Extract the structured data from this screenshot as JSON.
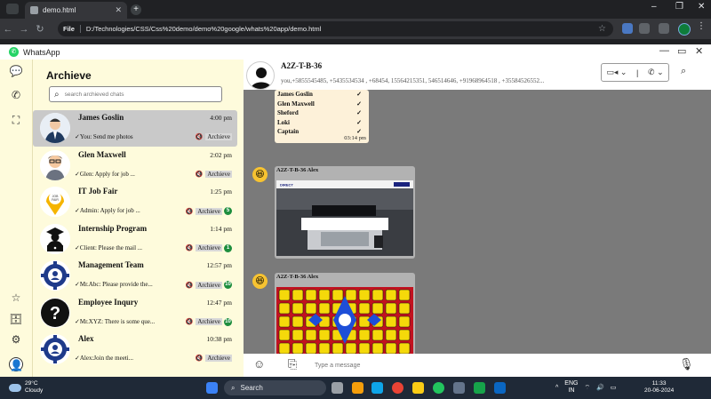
{
  "browser": {
    "tab_title": "demo.html",
    "address_scheme": "File",
    "address": "D:/Technologies/CSS/Css%20demo/demo%20google/whats%20app/demo.html",
    "new_tab": "+",
    "close_tab": "✕"
  },
  "app": {
    "title": "WhatsApp",
    "min": "—",
    "max": "▭",
    "close": "✕"
  },
  "sidebar": {
    "title": "Archieve",
    "search_placeholder": "search archieved chats",
    "chats": [
      {
        "name": "James Goslin",
        "time": "4:00 pm",
        "preview": "You: Send me photos",
        "archive": "Archieve",
        "badge": "",
        "active": true,
        "icon": "man-suit-avatar-icon"
      },
      {
        "name": "Glen Maxwell",
        "time": "2:02 pm",
        "preview": "Glen: Apply for job ...",
        "archive": "Archieve",
        "badge": "",
        "active": false,
        "icon": "cartoon-man-avatar-icon"
      },
      {
        "name": "IT Job Fair",
        "time": "1:25 pm",
        "preview": "Admin: Apply for job ...",
        "archive": "Archieve",
        "badge": "5",
        "active": false,
        "icon": "job-fair-pin-icon"
      },
      {
        "name": "Internship Program",
        "time": "1:14 pm",
        "preview": "Client: Please the mail ...",
        "archive": "Archieve",
        "badge": "1",
        "active": false,
        "icon": "graduate-laptop-icon"
      },
      {
        "name": "Management Team",
        "time": "12:57 pm",
        "preview": "Mr.Abc: Please provide the...",
        "archive": "Archieve",
        "badge": "10",
        "active": false,
        "icon": "team-gear-icon"
      },
      {
        "name": "Employee Inqury",
        "time": "12:47 pm",
        "preview": "Mr.XYZ: There is some que...",
        "archive": "Archieve",
        "badge": "10",
        "active": false,
        "icon": "question-mark-icon"
      },
      {
        "name": "Alex",
        "time": "10:38 pm",
        "preview": "Alex:Join the meeti...",
        "archive": "Archieve",
        "badge": "",
        "active": false,
        "icon": "team-gear-icon"
      }
    ]
  },
  "chat_header": {
    "name": "A2Z-T-B-36",
    "members": "you,+5855545485, +5435534534 , +68454, 15564215351, 546514646, +91968964518 , +35584526552..."
  },
  "messages": {
    "name_list": [
      "James Goslin",
      "Glen Maxwell",
      "Sheford",
      "Loki",
      "Captain"
    ],
    "name_list_time": "03:14 pm",
    "image_sender_1": "A2Z-T-B-36 Alex",
    "image_sender_2": "A2Z-T-B-36 Alex",
    "website_logo": "DIRECT"
  },
  "compose": {
    "placeholder": "Type a message"
  },
  "taskbar": {
    "temp": "29°C",
    "weather": "Cloudy",
    "search": "Search",
    "lang": "ENG",
    "region": "IN",
    "time": "11:33",
    "date": "20-06-2024"
  },
  "colors": {
    "sidebar_bg": "#fefbdc",
    "chat_bg": "#7a7a7a",
    "badge": "#1e8e3e",
    "bubble": "#fdf1d9"
  }
}
